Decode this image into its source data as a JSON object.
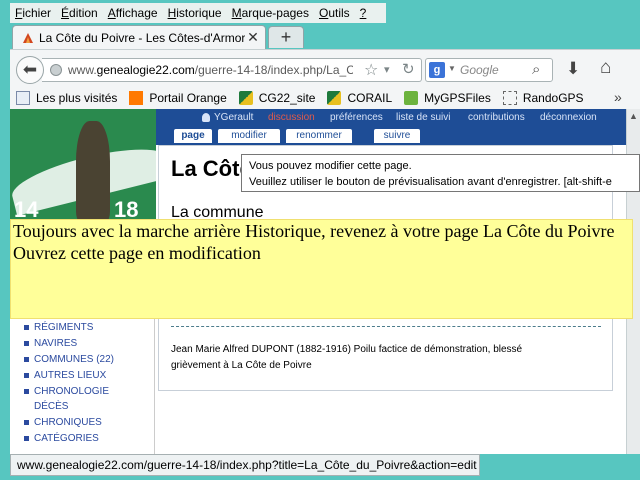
{
  "menubar": {
    "items": [
      {
        "key": "F",
        "rest": "ichier"
      },
      {
        "key": "É",
        "rest": "dition"
      },
      {
        "key": "A",
        "rest": "ffichage"
      },
      {
        "key": "H",
        "rest": "istorique"
      },
      {
        "key": "M",
        "rest": "arque-pages"
      },
      {
        "key": "O",
        "rest": "utils"
      },
      {
        "key": "?",
        "rest": ""
      }
    ]
  },
  "tabs": {
    "active_title": "La Côte du Poivre - Les Côtes-d'Armor d...",
    "new_tab_symbol": "+"
  },
  "navbar": {
    "url_prefix": "www.",
    "url_domain": "genealogie22.com",
    "url_path": "/guerre-14-18/index.php/La_C",
    "search_engine_letter": "g",
    "search_placeholder": "Google"
  },
  "bookmarks": {
    "items": [
      {
        "label": "Les plus visités",
        "icon": "page-icon"
      },
      {
        "label": "Portail Orange",
        "icon": "orange-icon"
      },
      {
        "label": "CG22_site",
        "icon": "cg22-icon"
      },
      {
        "label": "CORAIL",
        "icon": "cg22-icon"
      },
      {
        "label": "MyGPSFiles",
        "icon": "mygps-icon"
      },
      {
        "label": "RandoGPS",
        "icon": "dotted-folder-icon"
      }
    ]
  },
  "site": {
    "logo_year_left": "14",
    "logo_year_right": "18",
    "user_links": [
      "YGerault",
      "discussion",
      "préférences",
      "liste de suivi",
      "contributions",
      "déconnexion"
    ],
    "page_tabs": [
      "page",
      "modifier",
      "renommer",
      "suivre"
    ],
    "article_title": "La Côte",
    "section_heading": "La commune",
    "paragraph": "Jean Marie Alfred DUPONT (1882-1916) Poilu factice de démonstration, blessé grièvement à La Côte de Poivre",
    "sidebar_items": [
      "RÉGIMENTS",
      "NAVIRES",
      "COMMUNES (22)",
      "AUTRES LIEUX",
      "CHRONOLOGIE",
      "DÉCÈS",
      "CHRONIQUES",
      "CATÉGORIES"
    ]
  },
  "tooltip": {
    "line1": "Vous pouvez modifier cette page.",
    "line2": "Veuillez utiliser le bouton de prévisualisation avant d'enregistrer. [alt-shift-e"
  },
  "note": {
    "line1": "Toujours avec la marche arrière Historique, revenez à votre page La Côte du Poivre",
    "line2": "Ouvrez cette page en modification"
  },
  "statusbar": {
    "url": "www.genealogie22.com/guerre-14-18/index.php?title=La_Côte_du_Poivre&action=edit"
  },
  "colors": {
    "desktop": "#57c6c0",
    "site_band": "#1e4d96",
    "sidebar_link": "#2b4a9f",
    "note_background": "#ffff99",
    "user_link_active": "#e05a4a"
  }
}
